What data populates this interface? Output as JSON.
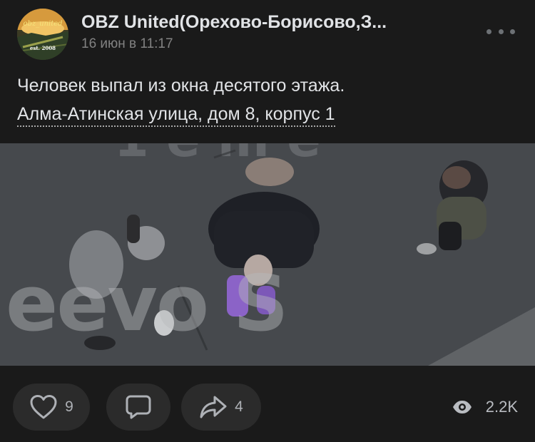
{
  "post": {
    "avatar": {
      "name_text": "obz_united",
      "est_text": "est. 2008"
    },
    "community_name": "OBZ United(Орехово-Борисово,З...",
    "date": "16 июн в 11:17",
    "text_line1": "Человек выпал из окна десятого этажа.",
    "address": "Алма-Атинская улица, дом 8, корпус 1",
    "photo": {
      "watermark": "eevo S"
    }
  },
  "actions": {
    "like_count": "9",
    "share_count": "4",
    "views": "2.2K"
  },
  "icons": {
    "more": "more-horizontal-icon",
    "like": "heart-icon",
    "comment": "comment-icon",
    "share": "share-arrow-icon",
    "views": "eye-icon"
  },
  "colors": {
    "background": "#1a1a1a",
    "text": "#e1e3e6",
    "secondary_text": "#828282",
    "button_bg": "#2b2b2b"
  }
}
